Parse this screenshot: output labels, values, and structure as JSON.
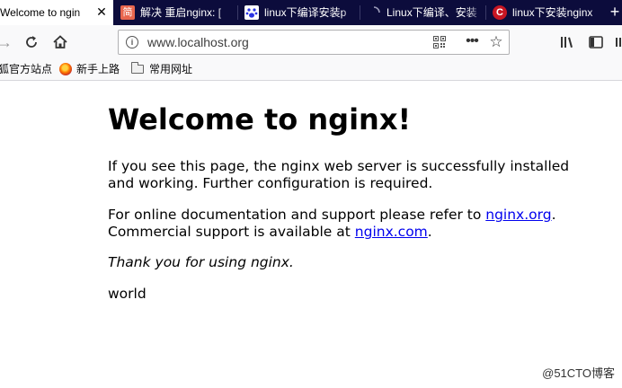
{
  "tabs": [
    {
      "label": "Welcome to ngin",
      "icon": "",
      "active": true
    },
    {
      "label": "解决 重启nginx: [",
      "icon": "简"
    },
    {
      "label": "linux下编译安装p",
      "icon": "paw"
    },
    {
      "label": "Linux下编译、安装",
      "icon": "spinner"
    },
    {
      "label": "linux下安装nginx",
      "icon": "C"
    }
  ],
  "navbar": {
    "url": "www.localhost.org"
  },
  "bookmarks": {
    "items": [
      "狐官方站点",
      "新手上路",
      "常用网址"
    ]
  },
  "page": {
    "title": "Welcome to nginx!",
    "para1": "If you see this page, the nginx web server is successfully installed and working. Further configuration is required.",
    "para2_pre": "For online documentation and support please refer to ",
    "para2_link1": "nginx.org",
    "para2_mid": ".",
    "para2_pre2": "Commercial support is available at ",
    "para2_link2": "nginx.com",
    "para2_end": ".",
    "thanks": "Thank you for using nginx.",
    "extra": "world"
  },
  "watermark": "@51CTO博客",
  "colors": {
    "tabbar_bg": "#0c0c3c",
    "toolbar_bg": "#f9f9fa",
    "link": "#0000ee"
  }
}
